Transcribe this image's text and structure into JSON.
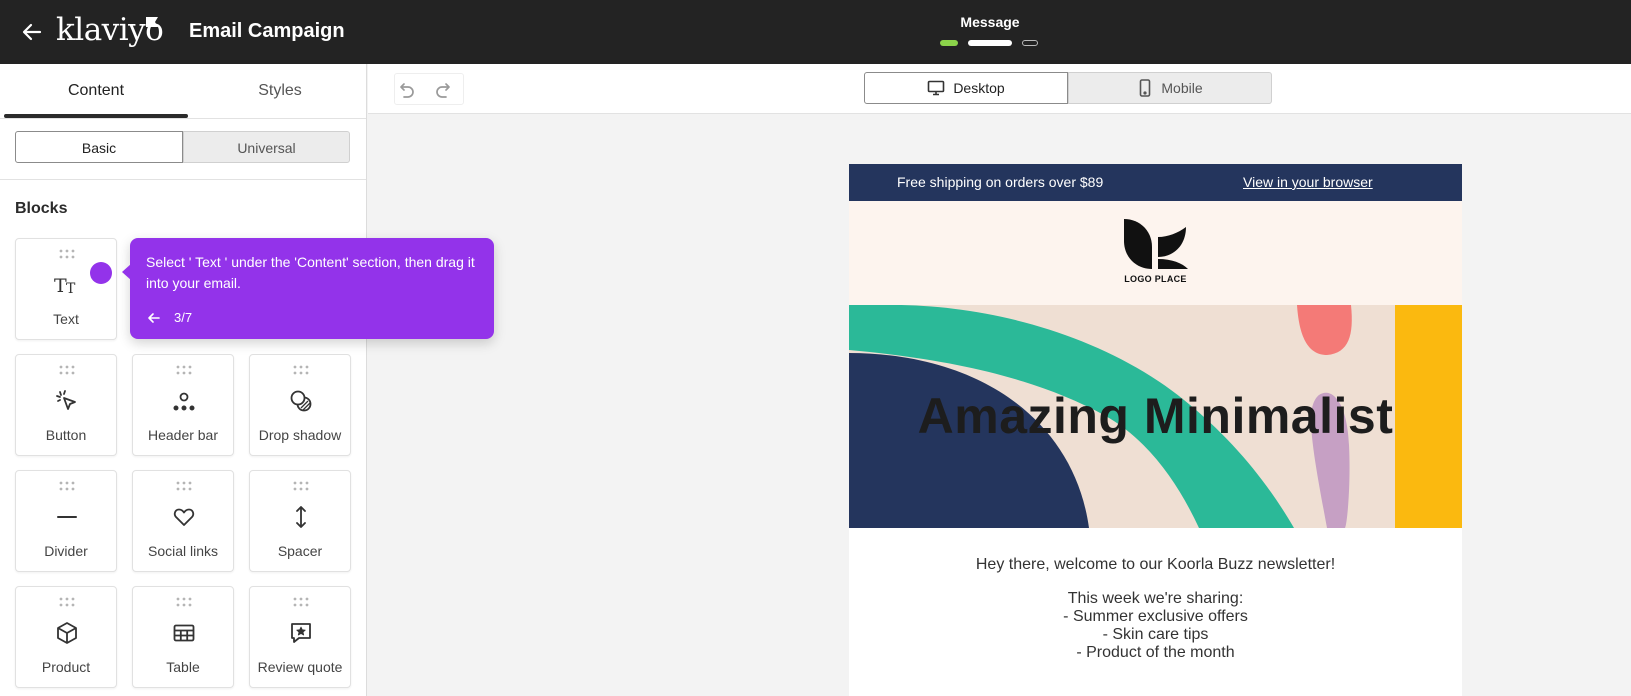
{
  "topbar": {
    "brand": "klaviyo",
    "title": "Email Campaign",
    "step_label": "Message"
  },
  "left_panel": {
    "tabs": [
      {
        "label": "Content",
        "active": true
      },
      {
        "label": "Styles",
        "active": false
      }
    ],
    "segments": [
      {
        "label": "Basic",
        "active": true
      },
      {
        "label": "Universal",
        "active": false
      }
    ],
    "blocks_heading": "Blocks",
    "blocks": [
      {
        "label": "Text",
        "icon": "text-icon"
      },
      {
        "label": "Button",
        "icon": "cursor-click-icon"
      },
      {
        "label": "Header bar",
        "icon": "header-bar-icon"
      },
      {
        "label": "Drop shadow",
        "icon": "drop-shadow-icon"
      },
      {
        "label": "Divider",
        "icon": "divider-icon"
      },
      {
        "label": "Social links",
        "icon": "heart-icon"
      },
      {
        "label": "Spacer",
        "icon": "spacer-icon"
      },
      {
        "label": "Product",
        "icon": "cube-icon"
      },
      {
        "label": "Table",
        "icon": "table-icon"
      },
      {
        "label": "Review quote",
        "icon": "review-quote-icon"
      }
    ]
  },
  "canvas": {
    "view_desktop": "Desktop",
    "view_mobile": "Mobile",
    "active_view": "Desktop"
  },
  "email": {
    "preheader_text": "Free shipping on orders over $89",
    "preheader_link": "View in your browser",
    "logo_text": "LOGO PLACE",
    "hero_title": "Amazing Minimalist",
    "greeting": "Hey there, welcome to our Koorla Buzz newsletter!",
    "sharing_lines": [
      "This week we're sharing:",
      "- Summer exclusive offers",
      "- Skin care tips",
      "- Product of the month"
    ]
  },
  "tooltip": {
    "text": "Select ' Text ' under the 'Content' section, then drag it into your email.",
    "progress": "3/7"
  },
  "colors": {
    "topbar": "#232323",
    "accent_purple": "#9333ea",
    "preheader_navy": "#24355d",
    "hero_navy": "#24355d",
    "hero_green": "#2bb998",
    "hero_coral": "#f47a77",
    "hero_yellow": "#fbb90f",
    "hero_lilac": "#c6a0c4",
    "hero_beige": "#efdfd3",
    "step_done_green": "#8bd34a"
  }
}
